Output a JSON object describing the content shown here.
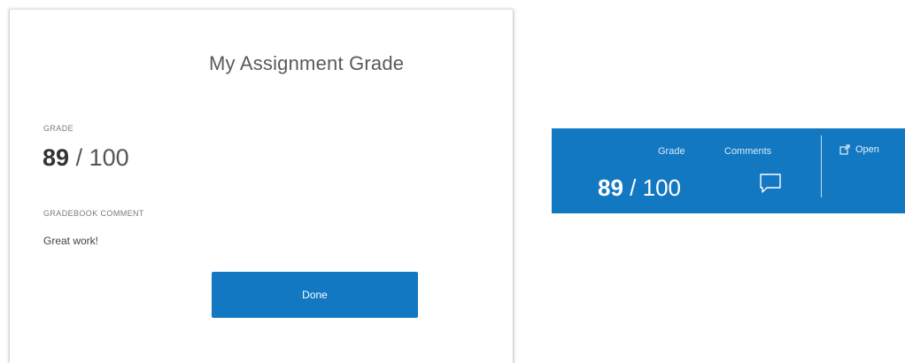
{
  "modal": {
    "title": "My Assignment Grade",
    "grade_label": "GRADE",
    "grade": {
      "score": "89",
      "separator": "/",
      "total": "100"
    },
    "comment_label": "GRADEBOOK COMMENT",
    "comment_text": "Great work!",
    "done_label": "Done"
  },
  "grade_bar": {
    "grade_label": "Grade",
    "grade": {
      "score": "89",
      "separator": "/",
      "total": "100"
    },
    "comments_label": "Comments",
    "comments_icon": "speech-bubble-icon",
    "open_label": "Open",
    "open_icon": "external-link-icon"
  },
  "colors": {
    "accent": "#1278c1",
    "text": "#333333",
    "muted": "#7a7a7a"
  }
}
